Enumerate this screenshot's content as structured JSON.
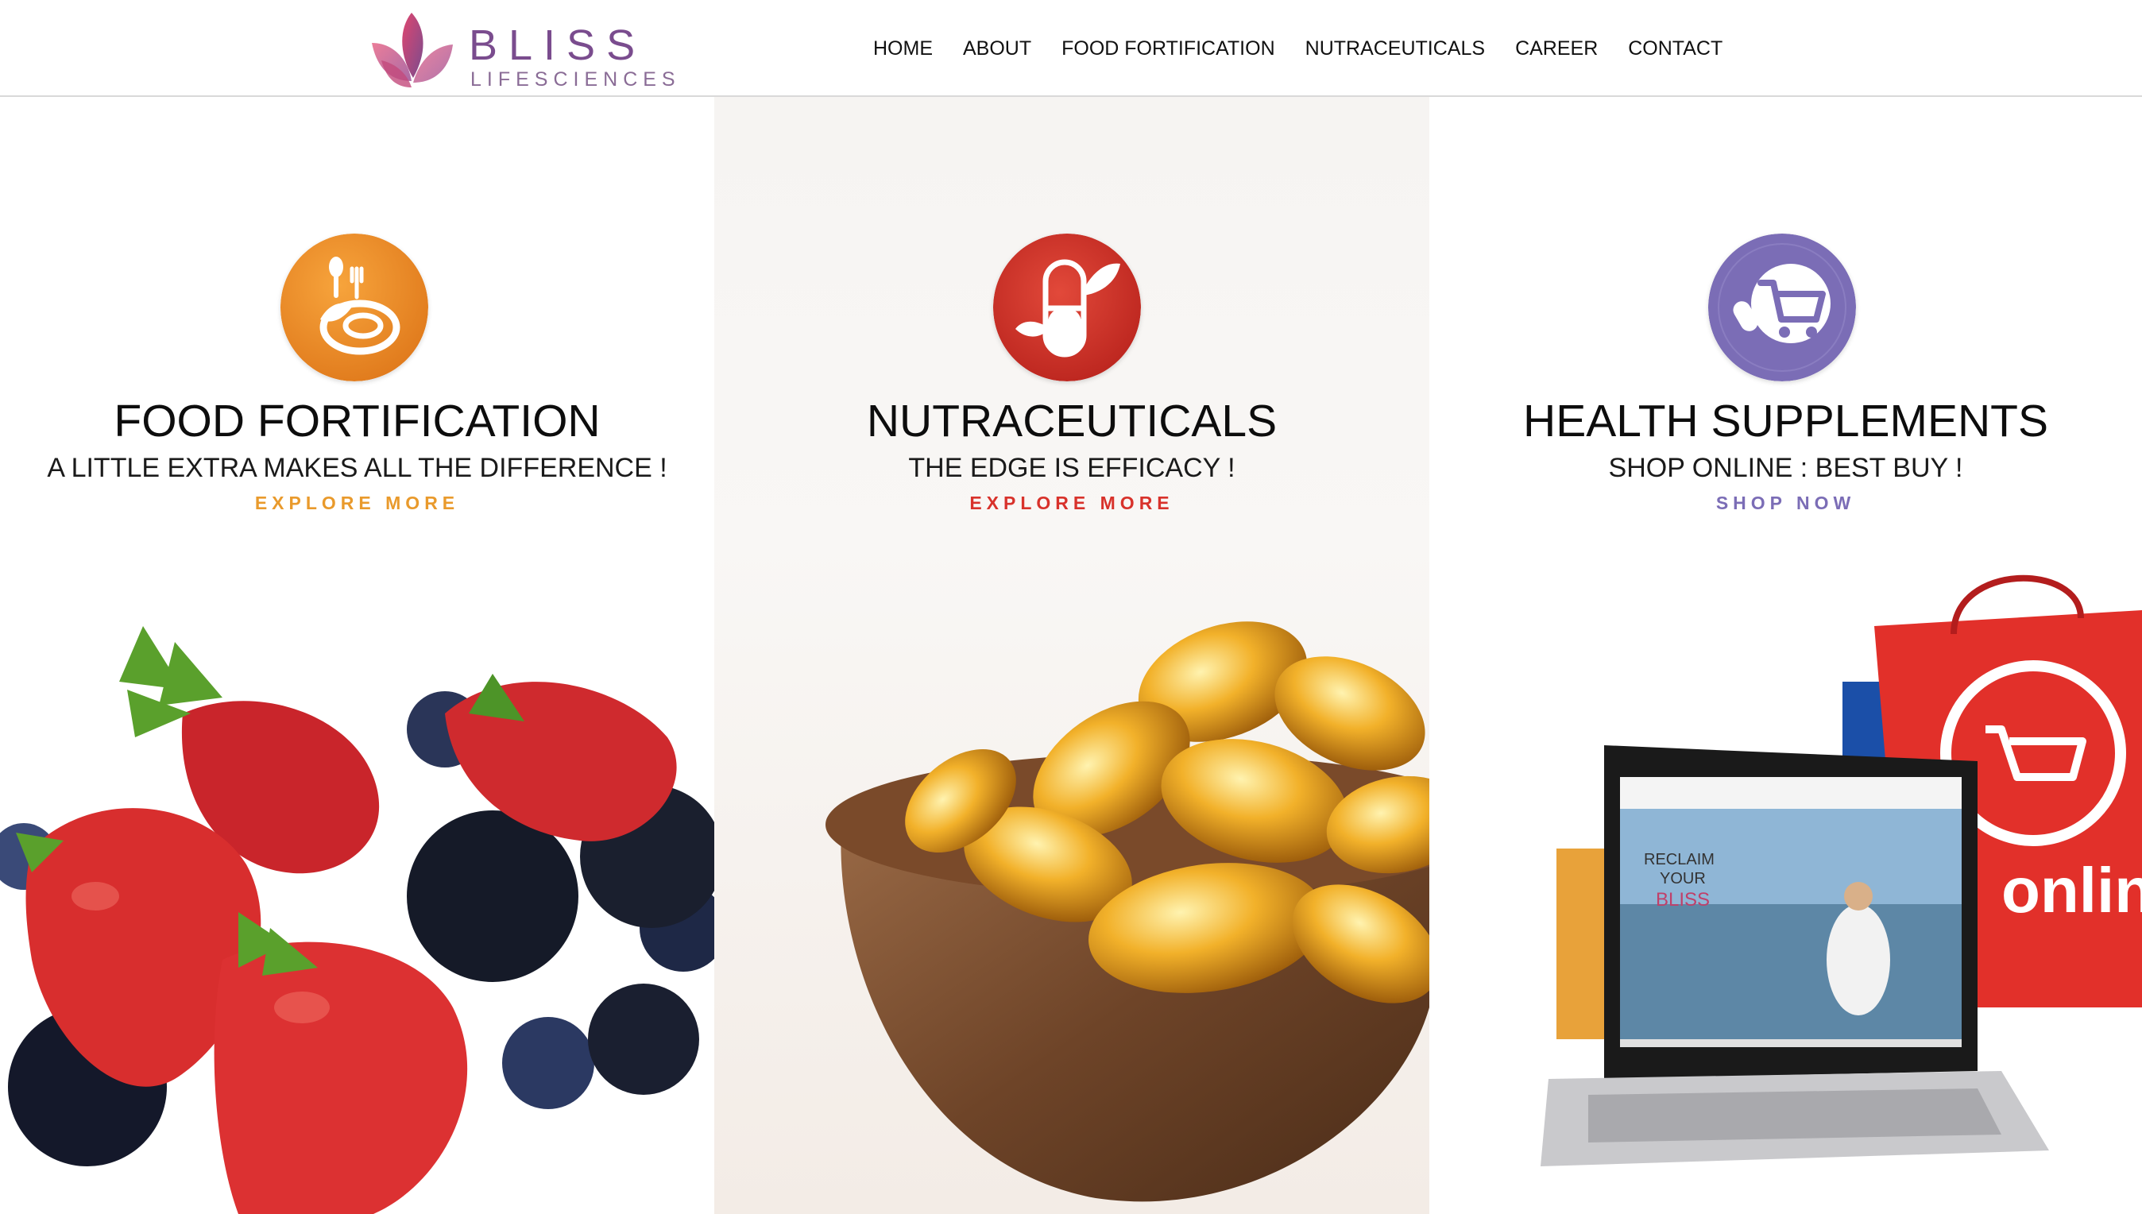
{
  "brand": {
    "name": "BLISS",
    "sub": "LIFESCIENCES",
    "colors": {
      "primary": "#7a4c8e",
      "accent": "#d8456e"
    }
  },
  "nav": {
    "items": [
      {
        "label": "HOME"
      },
      {
        "label": "ABOUT"
      },
      {
        "label": "FOOD FORTIFICATION"
      },
      {
        "label": "NUTRACEUTICALS"
      },
      {
        "label": "CAREER"
      },
      {
        "label": "CONTACT"
      }
    ]
  },
  "panels": [
    {
      "title": "FOOD FORTIFICATION",
      "subtitle": "A LITTLE EXTRA MAKES ALL THE DIFFERENCE !",
      "cta": "EXPLORE MORE",
      "icon": "food-bowl-icon",
      "color": "#e88a25",
      "image": "berries-photo"
    },
    {
      "title": "NUTRACEUTICALS",
      "subtitle": "THE EDGE IS EFFICACY !",
      "cta": "EXPLORE MORE",
      "icon": "capsule-leaf-icon",
      "color": "#d63a2c",
      "image": "softgel-bowl-photo"
    },
    {
      "title": "HEALTH SUPPLEMENTS",
      "subtitle": "SHOP ONLINE : BEST BUY !",
      "cta": "SHOP NOW",
      "icon": "shopping-cart-icon",
      "color": "#7b6db6",
      "image": "laptop-shopping-photo"
    }
  ],
  "laptop_screen": {
    "headline_1": "RECLAIM",
    "headline_2": "YOUR",
    "headline_3": "BLISS",
    "bag_label": "online"
  }
}
